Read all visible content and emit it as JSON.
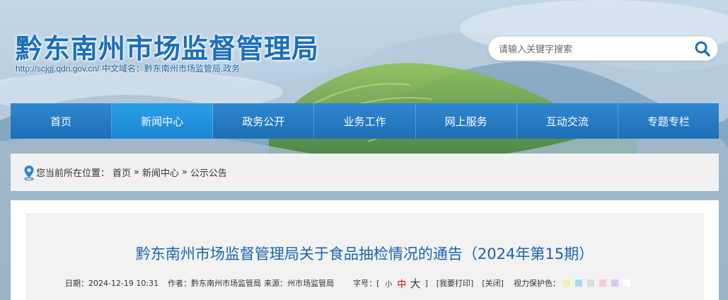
{
  "header": {
    "site_title": "黔东南州市场监督管理局",
    "site_url": "http://scjgj.qdn.gov.cn/",
    "cn_domain": "中文域名：黔东南州市场监管局.政务"
  },
  "search": {
    "placeholder": "请输入关键字搜索",
    "icon": "search-icon"
  },
  "nav": {
    "items": [
      {
        "label": "首页"
      },
      {
        "label": "新闻中心"
      },
      {
        "label": "政务公开"
      },
      {
        "label": "业务工作"
      },
      {
        "label": "网上服务"
      },
      {
        "label": "互动交流"
      },
      {
        "label": "专题专栏"
      }
    ],
    "active_index": 1
  },
  "breadcrumb": {
    "location_label": "您当前所在位置：",
    "items": [
      "首页",
      "新闻中心",
      "公示公告"
    ],
    "separator": "»",
    "icon": "location-pin-icon"
  },
  "article": {
    "title": "黔东南州市场监督管理局关于食品抽检情况的通告（2024年第15期）",
    "date": "日期：2024-12-19 10:31",
    "author": "作者：黔东南州市场监管局",
    "source": "来源：州市场监管局",
    "font_size_label": "字号：[",
    "font_small": "小",
    "font_medium": "中",
    "font_large": "大",
    "font_size_close": "]",
    "print": "[我要打印]",
    "close": "[关闭]",
    "eye_care_label": "视力保护色：",
    "eye_care_colors": [
      "#f5f0b4",
      "#a9dcf2",
      "#dcdcdc",
      "#f6cdd8",
      "#ddc6f2",
      "#ffffff"
    ]
  },
  "colors": {
    "brand_blue": "#1a6fbd",
    "nav_blue": "#1e6fb6",
    "nav_active": "#1a86d4",
    "title_blue": "#1a64b0",
    "font_medium_red": "#d40000"
  }
}
